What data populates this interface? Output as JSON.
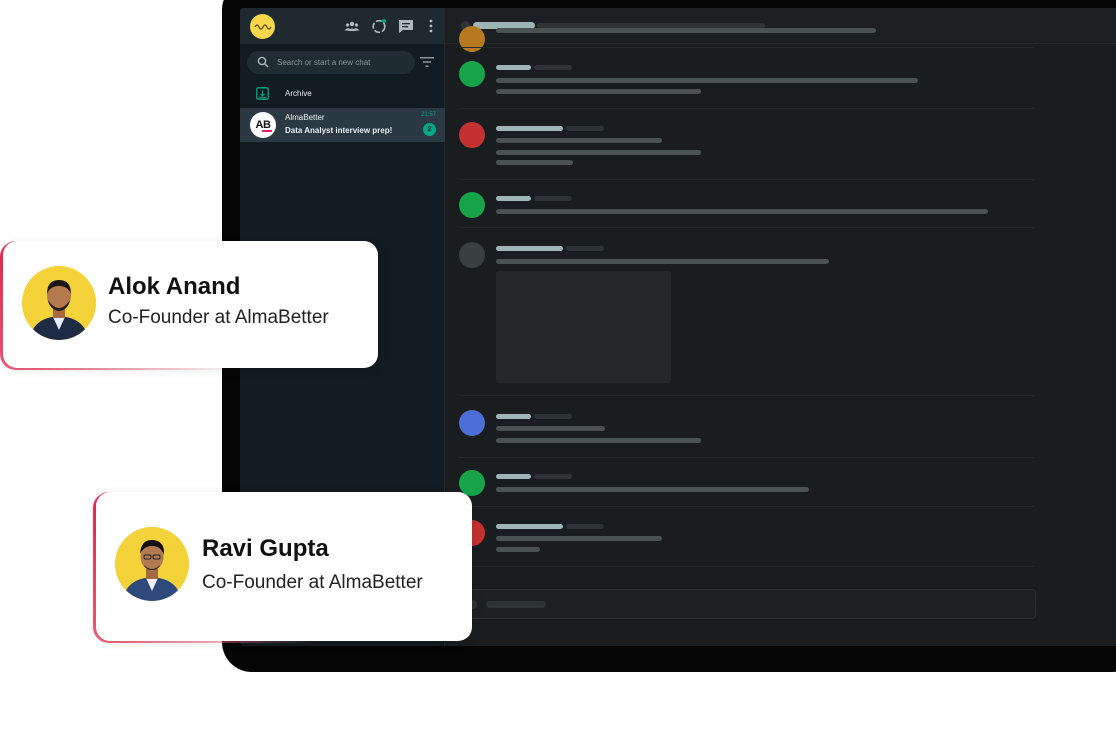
{
  "chat_app": {
    "search_placeholder": "Search or start a new chat",
    "archive_label": "Archive",
    "chat": {
      "avatar_text": "AB",
      "name": "AlmaBetter",
      "last_message": "Data Analyst interview prep!",
      "time": "21:57",
      "unread_count": "2"
    },
    "header_icons": [
      "community-icon",
      "status-icon",
      "new-chat-icon",
      "menu-dots-icon"
    ],
    "accent_color": "#00a884",
    "message_avatar_colors": [
      "#b7791f",
      "#16a34a",
      "#c53030",
      "#16a34a",
      "#4a5254",
      "#4c6ed7",
      "#16a34a",
      "#c53030"
    ]
  },
  "profiles": [
    {
      "name": "Alok Anand",
      "role": "Co-Founder at AlmaBetter"
    },
    {
      "name": "Ravi Gupta",
      "role": "Co-Founder at AlmaBetter"
    }
  ],
  "brand": {
    "accent": "#e8264f",
    "photo_bg": "#f3d23a"
  }
}
